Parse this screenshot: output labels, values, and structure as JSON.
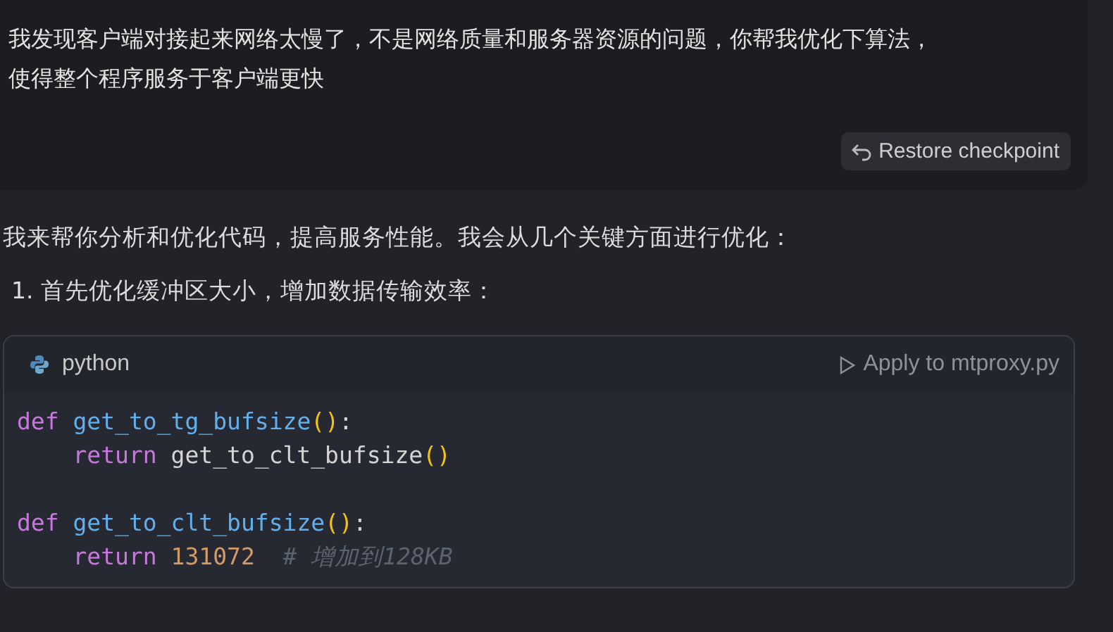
{
  "user_message": {
    "lines": [
      "我发现客户端对接起来网络太慢了，不是网络质量和服务器资源的问题，你帮我优化下算法，",
      "使得整个程序服务于客户端更快"
    ],
    "restore_button": "Restore checkpoint"
  },
  "reply": {
    "intro": "我来帮你分析和优化代码，提高服务性能。我会从几个关键方面进行优化：",
    "list_item": {
      "number": "1.",
      "text": "首先优化缓冲区大小，增加数据传输效率："
    },
    "code_block": {
      "language": "python",
      "apply_button": "Apply to mtproxy.py",
      "paragraphs": [
        [
          {
            "indented": false,
            "tokens": [
              {
                "kind": "keyword",
                "text": "def "
              },
              {
                "kind": "function",
                "text": "get_to_tg_bufsize"
              },
              {
                "kind": "bracket",
                "text": "()"
              },
              {
                "kind": "plain",
                "text": ":"
              }
            ]
          },
          {
            "indented": true,
            "tokens": [
              {
                "kind": "keyword",
                "text": "return "
              },
              {
                "kind": "plain",
                "text": "get_to_clt_bufsize"
              },
              {
                "kind": "bracket",
                "text": "()"
              }
            ]
          }
        ],
        [
          {
            "indented": false,
            "tokens": [
              {
                "kind": "keyword",
                "text": "def "
              },
              {
                "kind": "function",
                "text": "get_to_clt_bufsize"
              },
              {
                "kind": "bracket",
                "text": "()"
              },
              {
                "kind": "plain",
                "text": ":"
              }
            ]
          },
          {
            "indented": true,
            "tokens": [
              {
                "kind": "keyword",
                "text": "return "
              },
              {
                "kind": "number",
                "text": "131072"
              },
              {
                "kind": "comment",
                "text": "# 增加到128KB"
              }
            ]
          }
        ]
      ]
    }
  }
}
